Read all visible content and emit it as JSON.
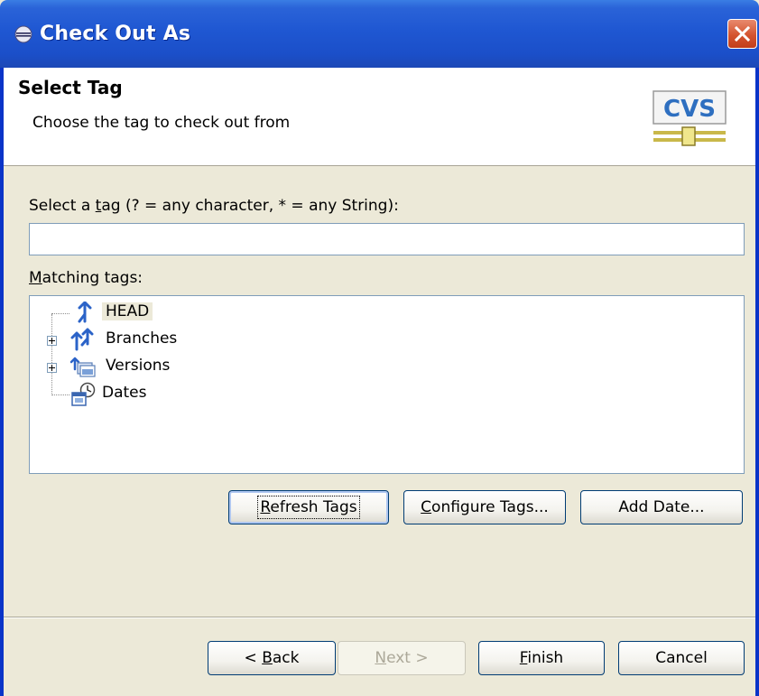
{
  "window": {
    "title": "Check Out As"
  },
  "header": {
    "title": "Select Tag",
    "description": "Choose the tag to check out from",
    "logo_text": "CVS"
  },
  "filter": {
    "label_pre": "Select a ",
    "label_mnemonic": "t",
    "label_post": "ag (? = any character, * = any String):",
    "value": ""
  },
  "matching": {
    "label_mnemonic": "M",
    "label_rest": "atching tags:"
  },
  "tree": {
    "items": [
      {
        "label": "HEAD",
        "icon": "head-tag-icon",
        "selected": true,
        "expandable": false
      },
      {
        "label": "Branches",
        "icon": "branches-icon",
        "selected": false,
        "expandable": true
      },
      {
        "label": "Versions",
        "icon": "versions-icon",
        "selected": false,
        "expandable": true
      },
      {
        "label": "Dates",
        "icon": "dates-icon",
        "selected": false,
        "expandable": false
      }
    ]
  },
  "tag_buttons": {
    "refresh": {
      "mnemonic": "R",
      "rest": "efresh Tags"
    },
    "configure": {
      "mnemonic": "C",
      "rest": "onfigure Tags..."
    },
    "add_date": {
      "label": "Add Date..."
    }
  },
  "footer": {
    "back": {
      "pre": "< ",
      "mnemonic": "B",
      "rest": "ack"
    },
    "next": {
      "mnemonic": "N",
      "rest": "ext >"
    },
    "finish": {
      "mnemonic": "F",
      "rest": "inish"
    },
    "cancel": {
      "label": "Cancel"
    }
  },
  "colors": {
    "titlebar": "#1f57d2",
    "dialog_bg": "#ece9d8",
    "header_bg": "#ffffff",
    "tag_icon": "#2b63c8",
    "close_button": "#d4542f"
  }
}
